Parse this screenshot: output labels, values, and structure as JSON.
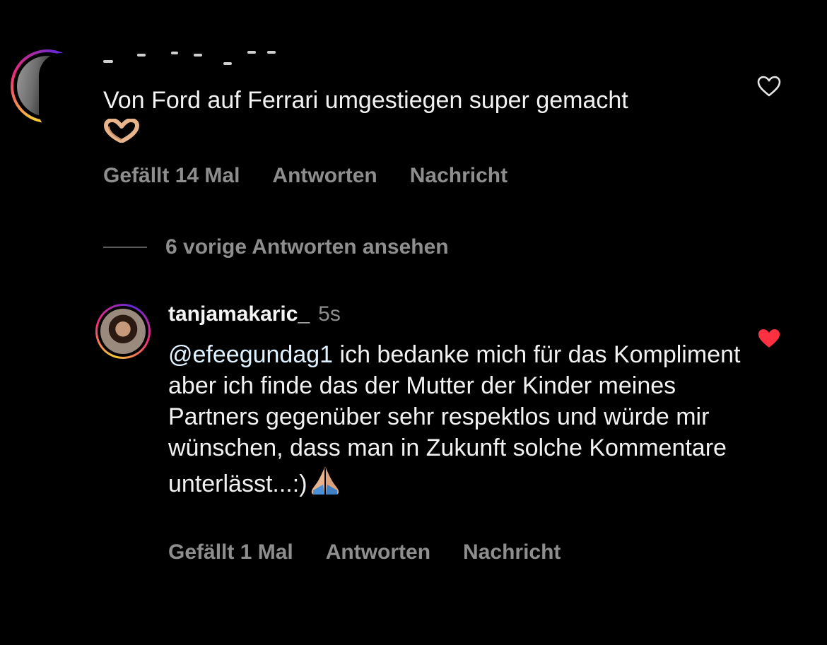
{
  "colors": {
    "background": "#000000",
    "text_primary": "#f2f2f2",
    "text_secondary": "#8e8e8e",
    "like_red": "#ff3040",
    "story_ring": [
      "#f9ce34",
      "#ee2a7b",
      "#6228d7"
    ]
  },
  "comment": {
    "text": "Von Ford auf Ferrari umgestiegen super gemacht",
    "emoji": "heart-hands-emoji",
    "likes_label": "Gefällt 14 Mal",
    "reply_label": "Antworten",
    "message_label": "Nachricht",
    "liked": false,
    "like_icon": "heart-outline-icon"
  },
  "view_replies": {
    "label": "6 vorige Antworten ansehen"
  },
  "reply": {
    "username": "tanjamakaric_",
    "timestamp": "5s",
    "mention": "@efeegundag1",
    "text": " ich bedanke mich für das Kompliment aber ich finde das der Mutter der Kinder meines Partners gegenüber sehr respektlos und würde mir wünschen, dass man in Zukunft solche Kommentare unterlässt...:)",
    "emoji": "folded-hands-emoji",
    "likes_label": "Gefällt 1 Mal",
    "reply_label": "Antworten",
    "message_label": "Nachricht",
    "liked": true,
    "like_icon": "heart-filled-icon"
  }
}
